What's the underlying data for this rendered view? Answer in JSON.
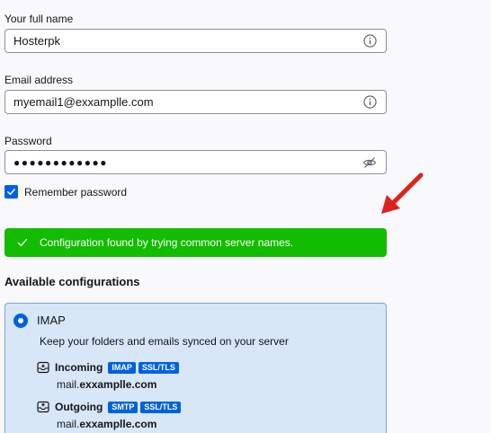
{
  "form": {
    "name_label": "Your full name",
    "name_value": "Hosterpk",
    "email_label": "Email address",
    "email_value": "myemail1@exxamplle.com",
    "password_label": "Password",
    "password_value": "●●●●●●●●●●●●",
    "remember_label": "Remember password",
    "remember_checked": true
  },
  "status": {
    "message": "Configuration found by trying common server names.",
    "color": "#12bc00"
  },
  "available": {
    "heading": "Available configurations",
    "configs": [
      {
        "protocol": "IMAP",
        "selected": true,
        "description": "Keep your folders and emails synced on your server",
        "incoming": {
          "label": "Incoming",
          "badges": [
            "IMAP",
            "SSL/TLS"
          ],
          "host_prefix": "mail.",
          "host_domain": "exxamplle.com"
        },
        "outgoing": {
          "label": "Outgoing",
          "badges": [
            "SMTP",
            "SSL/TLS"
          ],
          "host_prefix": "mail.",
          "host_domain": "exxamplle.com"
        }
      }
    ]
  },
  "colors": {
    "accent": "#0061e0",
    "card_bg": "#d7e7f7",
    "arrow": "#e0201a"
  },
  "icons": {
    "info": "info-icon",
    "password_toggle": "eye-slash-icon",
    "check": "check-icon",
    "incoming": "inbox-download-icon",
    "outgoing": "outbox-upload-icon",
    "annotation": "red-arrow-icon"
  }
}
